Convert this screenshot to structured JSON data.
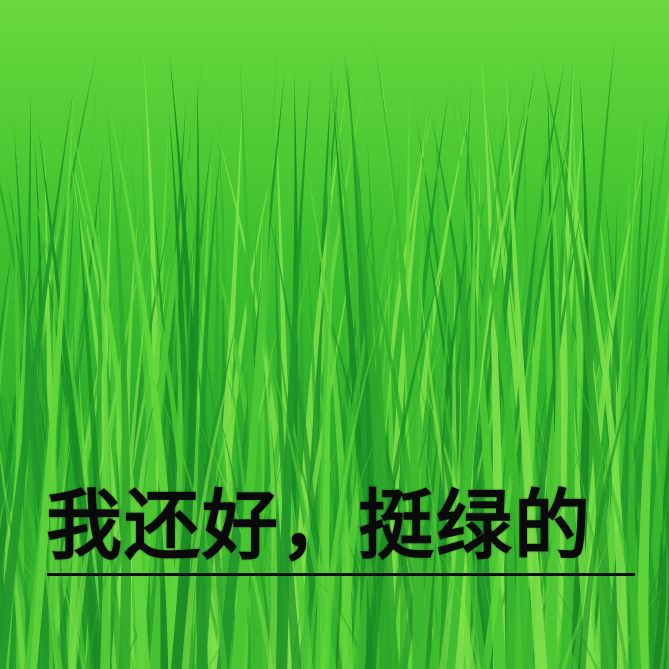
{
  "caption": {
    "text": "我还好，挺绿的"
  },
  "colors": {
    "grass_light": "#5bd83a",
    "grass_mid": "#2fb52a",
    "grass_dark": "#178a1c",
    "caption_text": "#0a0a0a"
  }
}
